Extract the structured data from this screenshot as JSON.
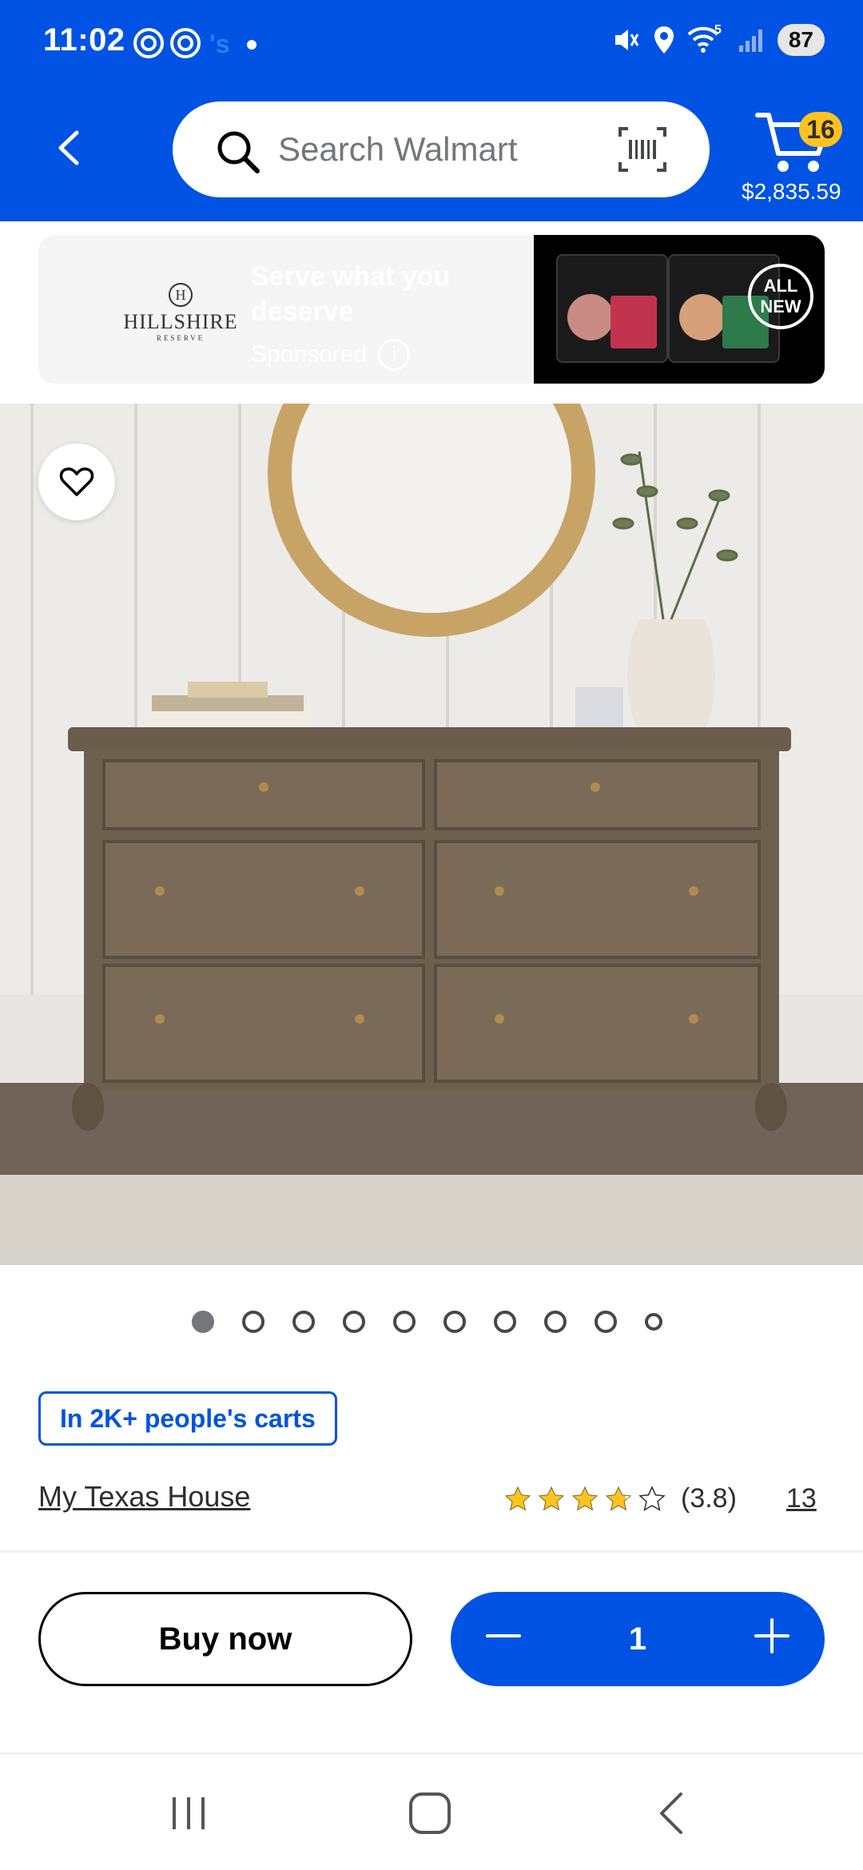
{
  "status_bar": {
    "time": "11:02",
    "battery": "87",
    "signal_superscript": "5"
  },
  "header": {
    "search_placeholder": "Search Walmart",
    "cart_count": "16",
    "cart_total": "$2,835.59"
  },
  "ad": {
    "brand_name": "HILLSHIRE",
    "brand_sub": "RESERVE",
    "headline": "Serve what you deserve",
    "sponsored_label": "Sponsored",
    "badge_text": "ALL NEW"
  },
  "carousel": {
    "count": 10,
    "active_index": 0
  },
  "product": {
    "cart_badge": "In 2K+ people's carts",
    "brand": "My Texas House",
    "rating": 3.8,
    "rating_text": "(3.8)",
    "review_count": "13"
  },
  "actions": {
    "buy_now": "Buy now",
    "quantity": "1"
  },
  "colors": {
    "brand_blue": "#0053e2",
    "spark_yellow": "#ffc220",
    "star": "#ffc220"
  },
  "icons": [
    "back-icon",
    "search-icon",
    "barcode-icon",
    "cart-icon",
    "heart-icon",
    "star-icon",
    "minus-icon",
    "plus-icon",
    "info-icon"
  ]
}
